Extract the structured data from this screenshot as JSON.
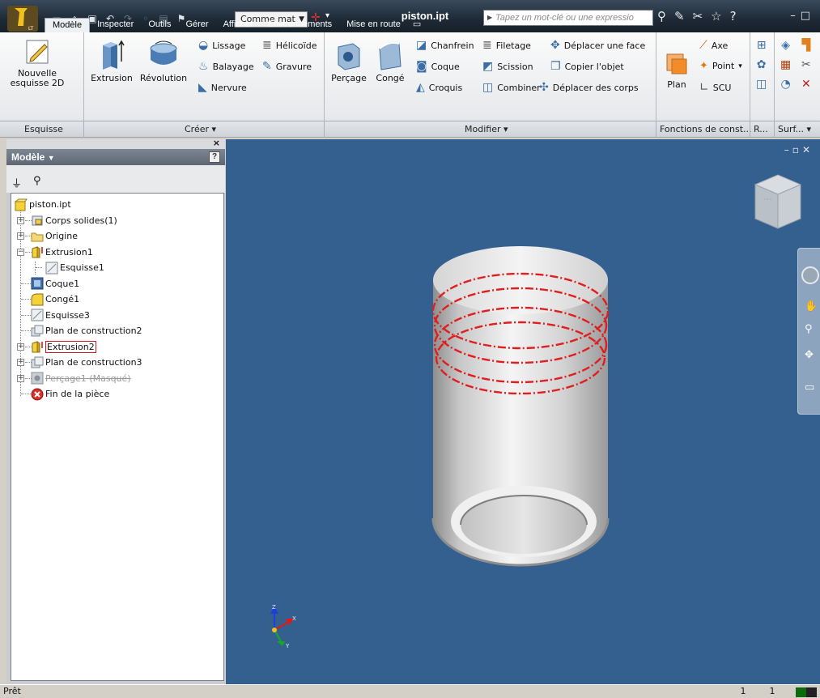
{
  "titlebar": {
    "material": "Comme mat",
    "document": "piston.ipt",
    "search_placeholder": "Tapez un mot-clé ou une expressio"
  },
  "tabs": [
    {
      "label": "Modèle",
      "active": true
    },
    {
      "label": "Inspecter"
    },
    {
      "label": "Outils"
    },
    {
      "label": "Gérer"
    },
    {
      "label": "Afficher"
    },
    {
      "label": "Environnements"
    },
    {
      "label": "Mise en route"
    }
  ],
  "ribbon": {
    "esquisse": {
      "new_sketch_line1": "Nouvelle",
      "new_sketch_line2": "esquisse 2D"
    },
    "creer": {
      "extrusion": "Extrusion",
      "revolution": "Révolution",
      "lissage": "Lissage",
      "balayage": "Balayage",
      "nervure": "Nervure",
      "helicoide": "Hélicoïde",
      "gravure": "Gravure"
    },
    "modifier": {
      "percage": "Perçage",
      "conge": "Congé",
      "chanfrein": "Chanfrein",
      "coque": "Coque",
      "croquis": "Croquis",
      "filetage": "Filetage",
      "scission": "Scission",
      "combiner": "Combiner",
      "deplacer_face": "Déplacer une face",
      "copier_objet": "Copier l'objet",
      "deplacer_corps": "Déplacer des corps"
    },
    "fonctions": {
      "plan": "Plan",
      "axe": "Axe",
      "point": "Point",
      "scu": "SCU"
    },
    "panels": {
      "esquisse": "Esquisse",
      "creer": "Créer",
      "modifier": "Modifier",
      "fonctions": "Fonctions de const...",
      "r": "R...",
      "surf": "Surf..."
    }
  },
  "browser": {
    "title": "Modèle",
    "help": "?",
    "tree": [
      {
        "label": "piston.ipt",
        "icon": "part-icon",
        "expander": null
      },
      {
        "label": "Corps solides(1)",
        "icon": "solid-bodies-icon",
        "expander": "+"
      },
      {
        "label": "Origine",
        "icon": "folder-icon",
        "expander": "+"
      },
      {
        "label": "Extrusion1",
        "icon": "extrusion-icon",
        "expander": "-"
      },
      {
        "label": "Esquisse1",
        "icon": "sketch-icon",
        "expander": null
      },
      {
        "label": "Coque1",
        "icon": "shell-icon",
        "expander": null
      },
      {
        "label": "Congé1",
        "icon": "fillet-icon",
        "expander": null
      },
      {
        "label": "Esquisse3",
        "icon": "sketch-icon",
        "expander": null
      },
      {
        "label": "Plan de construction2",
        "icon": "work-plane-icon",
        "expander": null
      },
      {
        "label": "Extrusion2",
        "icon": "extrusion-icon",
        "expander": "+",
        "selected": true
      },
      {
        "label": "Plan de construction3",
        "icon": "work-plane-icon",
        "expander": "+"
      },
      {
        "label": "Perçage1 (Masqué)",
        "icon": "hole-icon",
        "expander": "+",
        "suppressed": true
      },
      {
        "label": "Fin de la pièce",
        "icon": "end-of-part-icon",
        "expander": null
      }
    ]
  },
  "status": {
    "text": "Prêt",
    "cell1": "1",
    "cell2": "1"
  },
  "colors": {
    "viewport": "#33608f",
    "highlight": "#e01e1e"
  }
}
